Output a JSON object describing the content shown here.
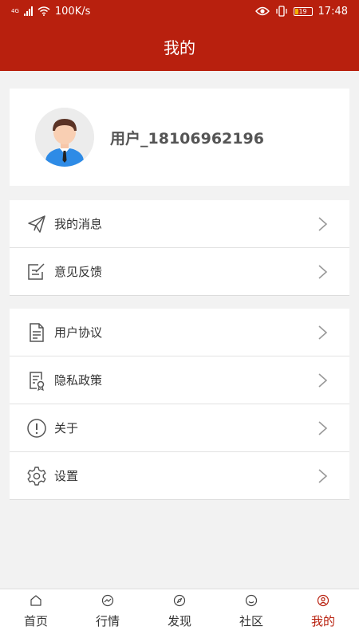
{
  "status_bar": {
    "network_type": "4G",
    "speed": "100K/s",
    "battery": "19",
    "time": "17:48"
  },
  "header": {
    "title": "我的"
  },
  "profile": {
    "username": "用户_18106962196"
  },
  "menu_groups": [
    {
      "items": [
        {
          "label": "我的消息",
          "icon": "paper-plane-icon"
        },
        {
          "label": "意见反馈",
          "icon": "feedback-edit-icon"
        }
      ]
    },
    {
      "items": [
        {
          "label": "用户协议",
          "icon": "document-icon"
        },
        {
          "label": "隐私政策",
          "icon": "privacy-document-icon"
        },
        {
          "label": "关于",
          "icon": "info-exclamation-icon"
        },
        {
          "label": "设置",
          "icon": "gear-icon"
        }
      ]
    }
  ],
  "tab_bar": {
    "active": "我的",
    "tabs": [
      {
        "label": "首页",
        "icon": "home-icon"
      },
      {
        "label": "行情",
        "icon": "trend-icon"
      },
      {
        "label": "发现",
        "icon": "compass-icon"
      },
      {
        "label": "社区",
        "icon": "smile-icon"
      },
      {
        "label": "我的",
        "icon": "user-icon"
      }
    ]
  },
  "colors": {
    "brand": "#b8200e",
    "background": "#f2f2f2"
  }
}
